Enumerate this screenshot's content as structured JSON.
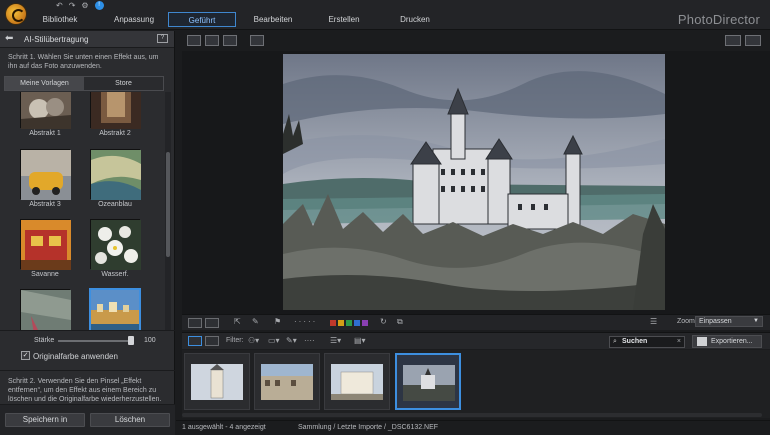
{
  "app": {
    "brand": "PhotoDirector"
  },
  "topbar": {
    "tabs": [
      {
        "label": "Bibliothek"
      },
      {
        "label": "Anpassung"
      },
      {
        "label": "Geführt",
        "active": true
      },
      {
        "label": "Bearbeiten"
      },
      {
        "label": "Erstellen"
      },
      {
        "label": "Drucken"
      }
    ],
    "quick_icons": [
      "undo-icon",
      "redo-icon",
      "settings-icon",
      "notification-icon"
    ]
  },
  "left_panel": {
    "title": "AI-Stilübertragung",
    "help_icon": "help-icon",
    "step1": "Schritt 1. Wählen Sie unten einen Effekt aus, um ihn auf das Foto anzuwenden.",
    "tabs": [
      {
        "label": "Meine Vorlagen",
        "active": true
      },
      {
        "label": "Store"
      }
    ],
    "styles": [
      {
        "label": "Abstrakt 1"
      },
      {
        "label": "Abstrakt 2"
      },
      {
        "label": "Abstrakt 3"
      },
      {
        "label": "Ozeanblau"
      },
      {
        "label": "Savanne"
      },
      {
        "label": "Wasserf."
      },
      {
        "label": ""
      },
      {
        "label": "",
        "selected": true
      }
    ],
    "strength": {
      "label": "Stärke",
      "value": "100",
      "fraction": 1.0
    },
    "keep_color": {
      "label": "Originalfarbe anwenden",
      "checked": true
    },
    "step2": "Schritt 2. Verwenden Sie den Pinsel „Effekt entfernen“, um den Effekt aus einem Bereich zu löschen und die Originalfarbe wiederherzustellen.",
    "buttons": {
      "save": "Speichern in",
      "delete": "Löschen"
    }
  },
  "toolbar": {
    "zoom_label": "Zoom:",
    "zoom_value": "Einpassen",
    "filter_label": "Filter:",
    "search_placeholder": "Suchen",
    "export_label": "Exportieren...",
    "color_labels": [
      "#c0392b",
      "#d4a017",
      "#2e9a4a",
      "#2f6fd1",
      "#8a3fb3"
    ]
  },
  "filmstrip": {
    "items": [
      {
        "name": "tower"
      },
      {
        "name": "courtyard"
      },
      {
        "name": "castle-street"
      },
      {
        "name": "castle-view",
        "selected": true
      }
    ]
  },
  "status": {
    "selection": "1 ausgewählt - 4 angezeigt",
    "path": "Sammlung / Letzte Importe / _DSC6132.NEF"
  }
}
